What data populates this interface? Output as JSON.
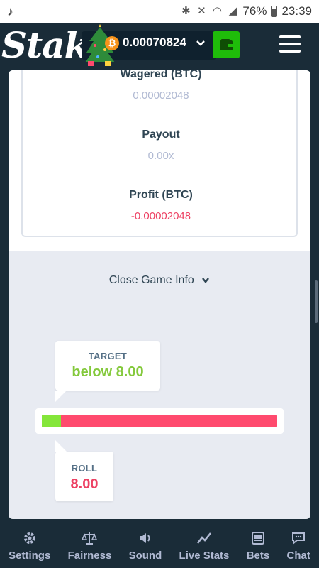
{
  "status_bar": {
    "battery": "76%",
    "time": "23:39"
  },
  "header": {
    "logo": "Stake",
    "balance": "0.00070824",
    "currency_icon": "bitcoin-icon"
  },
  "game_info": {
    "wagered_label": "Wagered (BTC)",
    "wagered_value": "0.00002048",
    "payout_label": "Payout",
    "payout_value": "0.00x",
    "profit_label": "Profit (BTC)",
    "profit_value": "-0.00002048",
    "close_label": "Close Game Info"
  },
  "slider": {
    "target_label": "TARGET",
    "target_value": "below 8.00",
    "roll_label": "ROLL",
    "roll_value": "8.00",
    "fill_percent": 8
  },
  "bottom_nav": [
    {
      "label": "Settings",
      "icon": "gear-icon"
    },
    {
      "label": "Fairness",
      "icon": "scale-icon"
    },
    {
      "label": "Sound",
      "icon": "speaker-icon"
    },
    {
      "label": "Live Stats",
      "icon": "chart-icon"
    },
    {
      "label": "Bets",
      "icon": "list-icon"
    },
    {
      "label": "Chat",
      "icon": "chat-icon"
    }
  ],
  "colors": {
    "accent_green": "#84e63a",
    "loss_red": "#ed4163",
    "wallet_green": "#1fbc0a"
  }
}
